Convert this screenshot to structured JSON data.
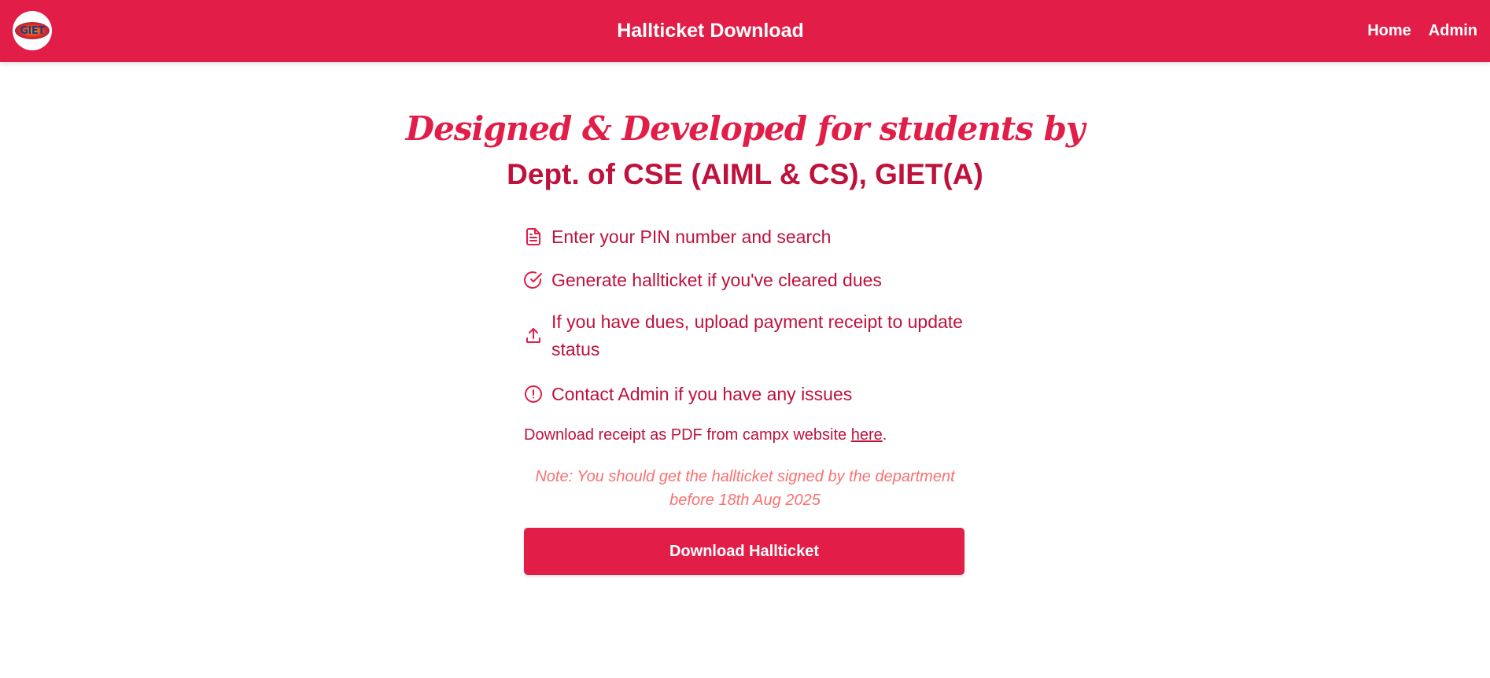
{
  "navbar": {
    "logo_text": "GIET",
    "title": "Hallticket Download",
    "links": [
      "Home",
      "Admin"
    ]
  },
  "hero": {
    "script_heading": "Designed & Developed for students by",
    "dept_heading": "Dept. of CSE (AIML & CS), GIET(A)"
  },
  "steps": [
    {
      "icon": "document-icon",
      "text": "Enter your PIN number and search"
    },
    {
      "icon": "check-circle-icon",
      "text": "Generate hallticket if you've cleared dues"
    },
    {
      "icon": "upload-icon",
      "text": "If you have dues, upload payment receipt to update status"
    },
    {
      "icon": "alert-circle-icon",
      "text": "Contact Admin if you have any issues"
    }
  ],
  "receipt": {
    "prefix": "Download receipt as PDF from campx website ",
    "link_text": "here",
    "suffix": "."
  },
  "note": "Note: You should get the hallticket signed by the department before 18th Aug 2025",
  "button": {
    "label": "Download Hallticket"
  },
  "colors": {
    "primary": "#e11d48",
    "text": "#be123c",
    "note": "#f87171"
  }
}
